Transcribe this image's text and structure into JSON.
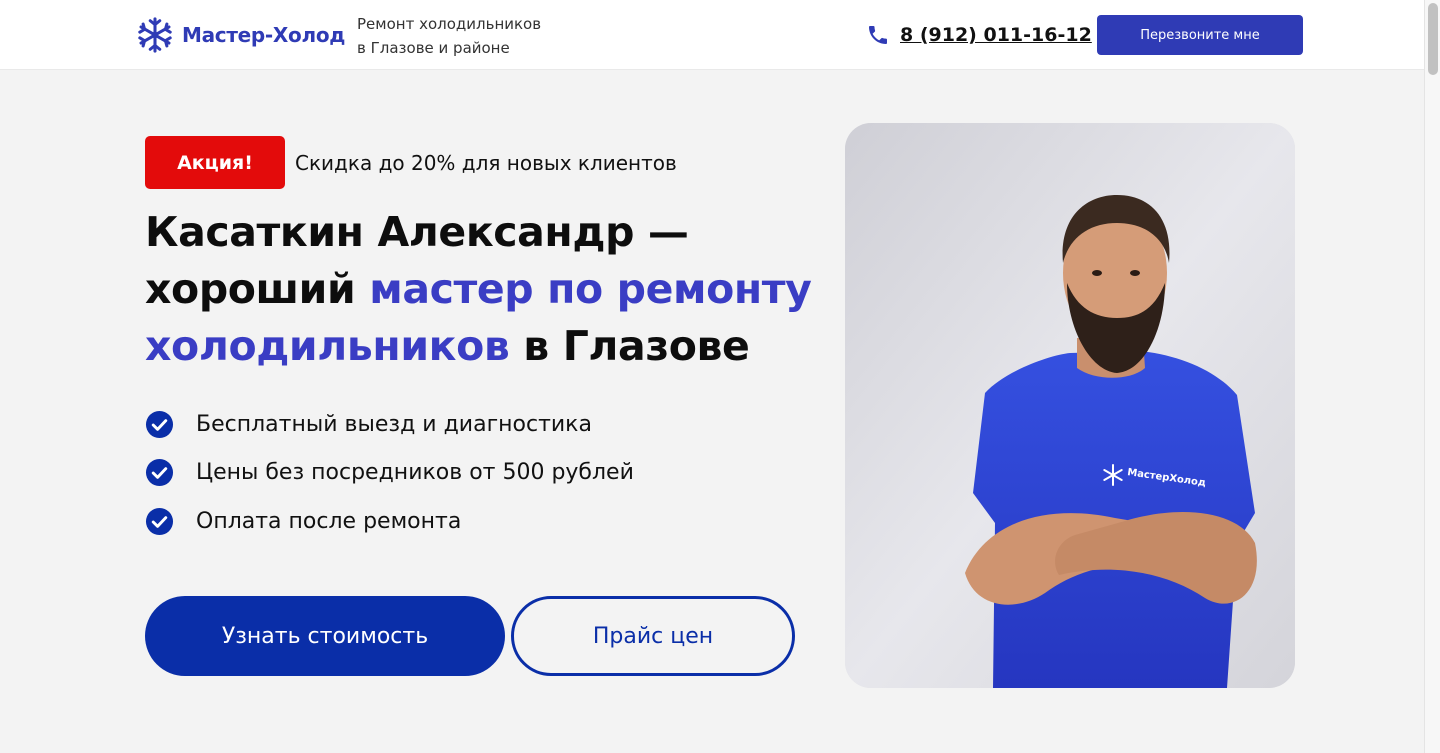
{
  "header": {
    "logo_text": "Мастер-Холод",
    "logo_icon": "snowflake-icon",
    "tagline_line1": "Ремонт холодильников",
    "tagline_line2": "в Глазове и районе",
    "phone": "8 (912) 011-16-12",
    "phone_icon": "phone-icon",
    "callback_label": "Перезвоните мне"
  },
  "hero": {
    "promo_badge": "Акция!",
    "promo_text": "Скидка до 20% для новых клиентов",
    "headline_part1": "Касаткин Александр — хороший ",
    "headline_accent": "мастер по ремонту холодильников",
    "headline_part2": " в Глазове",
    "features": [
      "Бесплатный выезд и диагностика",
      "Цены без посредников от 500 рублей",
      "Оплата после ремонта"
    ],
    "primary_button": "Узнать стоимость",
    "secondary_button": "Прайс цен",
    "photo_shirt_text": "МастерХолод"
  },
  "colors": {
    "brand_blue": "#2f3bb5",
    "accent_text": "#3a3dc4",
    "button_blue": "#0a2ea8",
    "promo_red": "#e30b0b",
    "background": "#f3f3f3"
  }
}
